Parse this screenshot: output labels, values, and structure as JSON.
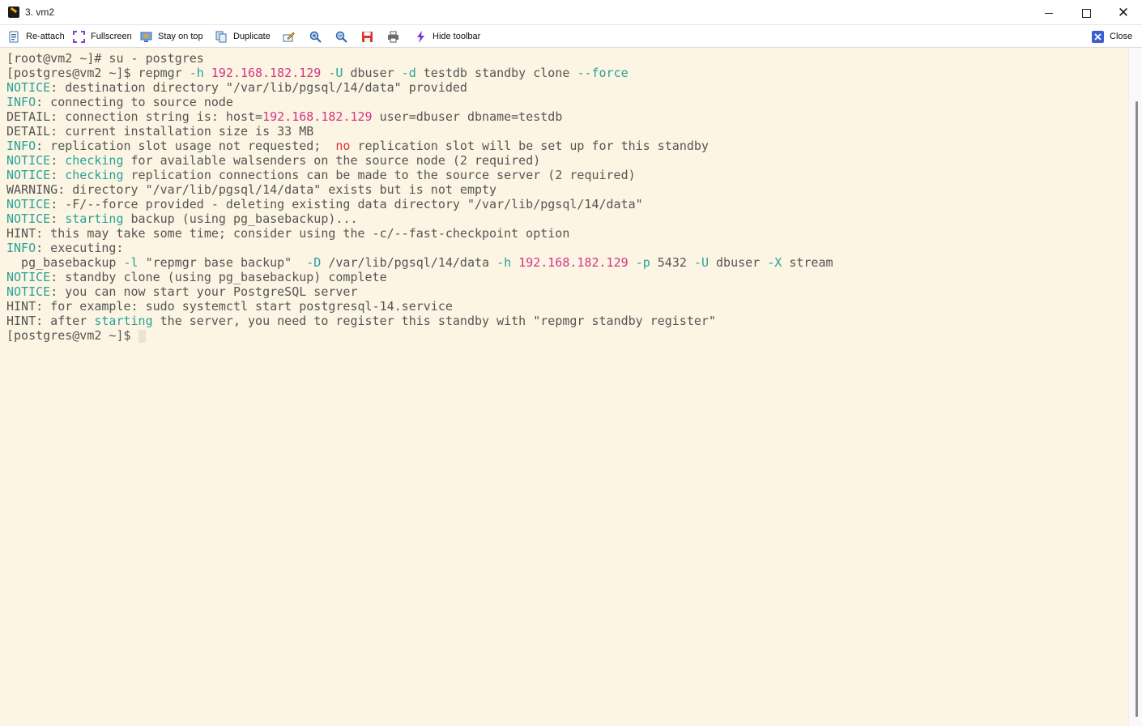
{
  "window": {
    "title": "3. vm2"
  },
  "toolbar": {
    "items": [
      {
        "label": "Re-attach",
        "icon": "reattach-icon"
      },
      {
        "label": "Fullscreen",
        "icon": "fullscreen-icon"
      },
      {
        "label": "Stay on top",
        "icon": "stay-on-top-icon"
      },
      {
        "label": "Duplicate",
        "icon": "duplicate-icon"
      },
      {
        "label": "",
        "icon": "edit-icon"
      },
      {
        "label": "",
        "icon": "zoom-in-icon"
      },
      {
        "label": "",
        "icon": "zoom-out-icon"
      },
      {
        "label": "",
        "icon": "save-icon"
      },
      {
        "label": "",
        "icon": "print-icon"
      },
      {
        "label": "Hide toolbar",
        "icon": "lightning-icon"
      }
    ],
    "close_label": "Close"
  },
  "colors": {
    "terminal_bg": "#fcf5e3",
    "text": "#555555",
    "cyan": "#2aa198",
    "magenta": "#d33682",
    "red": "#dc322f"
  },
  "terminal": {
    "lines": [
      [
        {
          "t": "[root@vm2 ~]# su - postgres"
        }
      ],
      [
        {
          "t": "[postgres@vm2 ~]$ repmgr "
        },
        {
          "t": "-h",
          "c": "cyan"
        },
        {
          "t": " "
        },
        {
          "t": "192.168.182.129",
          "c": "mag"
        },
        {
          "t": " "
        },
        {
          "t": "-U",
          "c": "cyan"
        },
        {
          "t": " dbuser "
        },
        {
          "t": "-d",
          "c": "cyan"
        },
        {
          "t": " testdb standby clone "
        },
        {
          "t": "--force",
          "c": "cyan"
        }
      ],
      [
        {
          "t": "NOTICE",
          "c": "cyan"
        },
        {
          "t": ": destination directory \"/var/lib/pgsql/14/data\" provided"
        }
      ],
      [
        {
          "t": "INFO",
          "c": "cyan"
        },
        {
          "t": ": connecting to source node"
        }
      ],
      [
        {
          "t": "DETAIL: connection string is: host="
        },
        {
          "t": "192.168.182.129",
          "c": "mag"
        },
        {
          "t": " user=dbuser dbname=testdb"
        }
      ],
      [
        {
          "t": "DETAIL: current installation size is 33 MB"
        }
      ],
      [
        {
          "t": "INFO",
          "c": "cyan"
        },
        {
          "t": ": replication slot usage not requested;  "
        },
        {
          "t": "no",
          "c": "red"
        },
        {
          "t": " replication slot will be set up for this standby"
        }
      ],
      [
        {
          "t": "NOTICE",
          "c": "cyan"
        },
        {
          "t": ": "
        },
        {
          "t": "checking",
          "c": "cyan"
        },
        {
          "t": " for available walsenders on the source node (2 required)"
        }
      ],
      [
        {
          "t": "NOTICE",
          "c": "cyan"
        },
        {
          "t": ": "
        },
        {
          "t": "checking",
          "c": "cyan"
        },
        {
          "t": " replication connections can be made to the source server (2 required)"
        }
      ],
      [
        {
          "t": "WARNING: directory \"/var/lib/pgsql/14/data\" exists but is not empty"
        }
      ],
      [
        {
          "t": "NOTICE",
          "c": "cyan"
        },
        {
          "t": ": -F/--force provided - deleting existing data directory \"/var/lib/pgsql/14/data\""
        }
      ],
      [
        {
          "t": "NOTICE",
          "c": "cyan"
        },
        {
          "t": ": "
        },
        {
          "t": "starting",
          "c": "cyan"
        },
        {
          "t": " backup (using pg_basebackup)..."
        }
      ],
      [
        {
          "t": "HINT: this may take some time; consider using the -c/--fast-checkpoint option"
        }
      ],
      [
        {
          "t": "INFO",
          "c": "cyan"
        },
        {
          "t": ": executing:"
        }
      ],
      [
        {
          "t": "  pg_basebackup "
        },
        {
          "t": "-l",
          "c": "cyan"
        },
        {
          "t": " \"repmgr base backup\"  "
        },
        {
          "t": "-D",
          "c": "cyan"
        },
        {
          "t": " /var/lib/pgsql/14/data "
        },
        {
          "t": "-h",
          "c": "cyan"
        },
        {
          "t": " "
        },
        {
          "t": "192.168.182.129",
          "c": "mag"
        },
        {
          "t": " "
        },
        {
          "t": "-p",
          "c": "cyan"
        },
        {
          "t": " 5432 "
        },
        {
          "t": "-U",
          "c": "cyan"
        },
        {
          "t": " dbuser "
        },
        {
          "t": "-X",
          "c": "cyan"
        },
        {
          "t": " stream"
        }
      ],
      [
        {
          "t": "NOTICE",
          "c": "cyan"
        },
        {
          "t": ": standby clone (using pg_basebackup) complete"
        }
      ],
      [
        {
          "t": "NOTICE",
          "c": "cyan"
        },
        {
          "t": ": you can now start your PostgreSQL server"
        }
      ],
      [
        {
          "t": "HINT: for example: sudo systemctl start postgresql-14.service"
        }
      ],
      [
        {
          "t": "HINT: after "
        },
        {
          "t": "starting",
          "c": "cyan"
        },
        {
          "t": " the server, you need to register this standby with \"repmgr standby register\""
        }
      ],
      [
        {
          "t": "[postgres@vm2 ~]$ "
        },
        {
          "t": "",
          "c": "cursor"
        }
      ]
    ]
  }
}
